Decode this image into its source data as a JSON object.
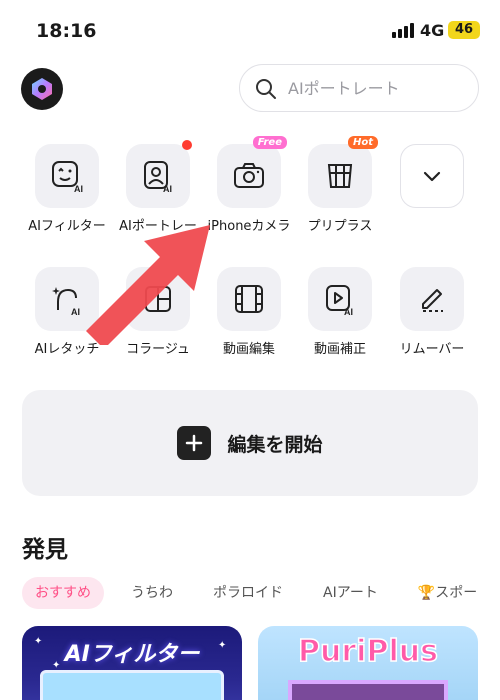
{
  "status_bar": {
    "time": "18:16",
    "network": "4G",
    "battery": "46"
  },
  "search": {
    "placeholder": "AIポートレート"
  },
  "tools_row1": [
    {
      "label": "AIフィルター",
      "icon": "face-ai-icon"
    },
    {
      "label": "AIポートレー",
      "icon": "portrait-ai-icon",
      "badge": "dot"
    },
    {
      "label": "iPhoneカメラ",
      "icon": "camera-icon",
      "badge_text": "Free"
    },
    {
      "label": "プリプラス",
      "icon": "collage-grid-icon",
      "badge_text": "Hot"
    },
    {
      "label": "",
      "icon": "chevron-down-icon"
    }
  ],
  "tools_row2": [
    {
      "label": "AIレタッチ",
      "icon": "retouch-ai-icon"
    },
    {
      "label": "コラージュ",
      "icon": "collage-icon"
    },
    {
      "label": "動画編集",
      "icon": "film-icon"
    },
    {
      "label": "動画補正",
      "icon": "video-enhance-icon"
    },
    {
      "label": "リムーバー",
      "icon": "eraser-icon"
    }
  ],
  "start_edit": {
    "label": "編集を開始"
  },
  "discover": {
    "title": "発見",
    "tabs": [
      "おすすめ",
      "うちわ",
      "ポラロイド",
      "AIアート",
      "🏆スポー"
    ],
    "active_tab": "おすすめ",
    "cards": [
      {
        "title": "AIフィルター"
      },
      {
        "title": "PuriPlus"
      }
    ]
  },
  "colors": {
    "accent_pink": "#ff4f86",
    "arrow_red": "#ef4a4f",
    "tile_bg": "#f0f0f4"
  }
}
